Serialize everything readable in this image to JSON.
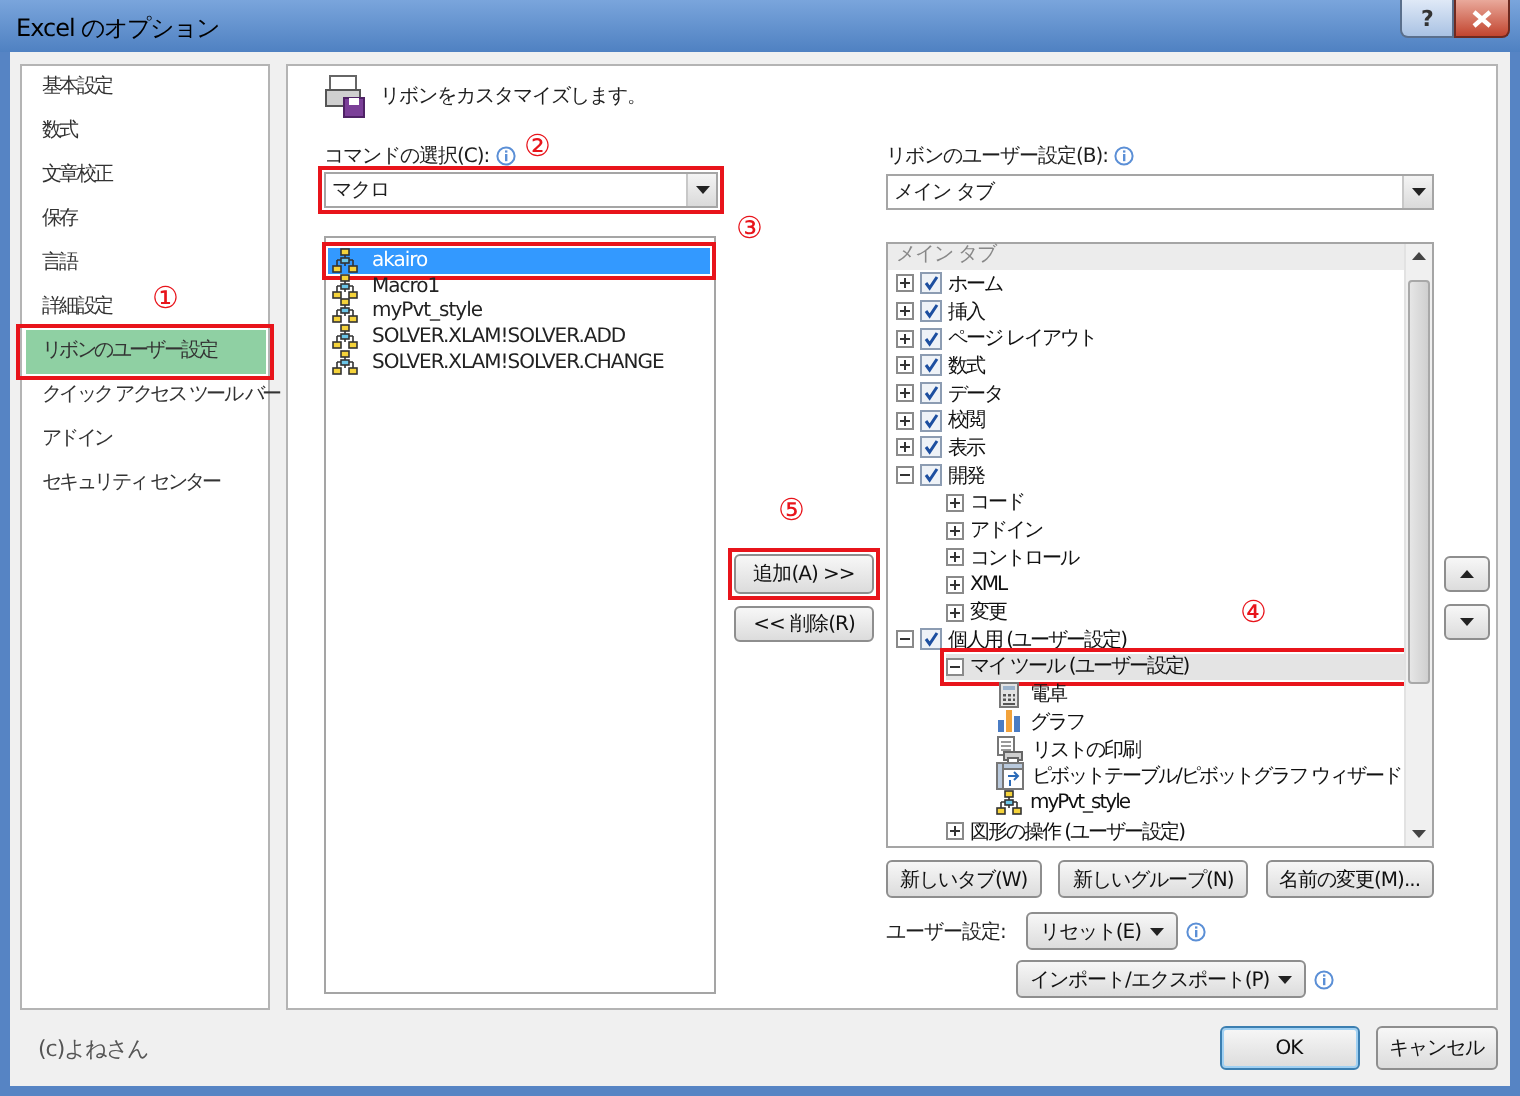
{
  "window": {
    "title": "Excel のオプション",
    "help": "?"
  },
  "nav": {
    "items": [
      {
        "label": "基本設定",
        "selected": false,
        "highlighted": false
      },
      {
        "label": "数式",
        "selected": false,
        "highlighted": false
      },
      {
        "label": "文章校正",
        "selected": false,
        "highlighted": false
      },
      {
        "label": "保存",
        "selected": false,
        "highlighted": false
      },
      {
        "label": "言語",
        "selected": false,
        "highlighted": false
      },
      {
        "label": "詳細設定",
        "selected": false,
        "highlighted": false
      },
      {
        "label": "リボンのユーザー設定",
        "selected": true,
        "highlighted": true,
        "marker": "①"
      },
      {
        "label": "クイック アクセス ツール バー",
        "selected": false,
        "highlighted": false
      },
      {
        "label": "アドイン",
        "selected": false,
        "highlighted": false
      },
      {
        "label": "セキュリティ センター",
        "selected": false,
        "highlighted": false
      }
    ]
  },
  "customize": {
    "heading": "リボンをカスタマイズします。",
    "commands": {
      "label": "コマンドの選択(C):",
      "combo": {
        "value": "マクロ",
        "highlighted": true,
        "marker": "②"
      },
      "items": [
        {
          "label": "akairo",
          "selected": true,
          "highlighted": true,
          "marker": "③"
        },
        {
          "label": "Macro1",
          "selected": false,
          "highlighted": false
        },
        {
          "label": "myPvt_style",
          "selected": false,
          "highlighted": false
        },
        {
          "label": "SOLVER.XLAM!SOLVER.ADD",
          "selected": false,
          "highlighted": false
        },
        {
          "label": "SOLVER.XLAM!SOLVER.CHANGE",
          "selected": false,
          "highlighted": false
        }
      ]
    },
    "move_buttons": [
      {
        "label": "追加(A) >>",
        "highlighted": true,
        "marker": "⑤"
      },
      {
        "label": "<< 削除(R)",
        "highlighted": false
      }
    ],
    "ribbon": {
      "label": "リボンのユーザー設定(B):",
      "combo": {
        "value": "メイン タブ",
        "highlighted": false
      },
      "tree": {
        "header": "メイン タブ",
        "items": [
          {
            "label": "ホーム",
            "kind": "tab",
            "expanded": false,
            "checked": true,
            "selected": false,
            "highlighted": false
          },
          {
            "label": "挿入",
            "kind": "tab",
            "expanded": false,
            "checked": true,
            "selected": false,
            "highlighted": false
          },
          {
            "label": "ページ レイアウト",
            "kind": "tab",
            "expanded": false,
            "checked": true,
            "selected": false,
            "highlighted": false
          },
          {
            "label": "数式",
            "kind": "tab",
            "expanded": false,
            "checked": true,
            "selected": false,
            "highlighted": false
          },
          {
            "label": "データ",
            "kind": "tab",
            "expanded": false,
            "checked": true,
            "selected": false,
            "highlighted": false
          },
          {
            "label": "校閲",
            "kind": "tab",
            "expanded": false,
            "checked": true,
            "selected": false,
            "highlighted": false
          },
          {
            "label": "表示",
            "kind": "tab",
            "expanded": false,
            "checked": true,
            "selected": false,
            "highlighted": false
          },
          {
            "label": "開発",
            "kind": "tab",
            "expanded": true,
            "checked": true,
            "selected": false,
            "highlighted": false,
            "children": [
              {
                "label": "コード",
                "kind": "group",
                "expanded": false,
                "selected": false,
                "highlighted": false
              },
              {
                "label": "アドイン",
                "kind": "group",
                "expanded": false,
                "selected": false,
                "highlighted": false
              },
              {
                "label": "コントロール",
                "kind": "group",
                "expanded": false,
                "selected": false,
                "highlighted": false
              },
              {
                "label": "XML",
                "kind": "group",
                "expanded": false,
                "selected": false,
                "highlighted": false
              },
              {
                "label": "変更",
                "kind": "group",
                "expanded": false,
                "selected": false,
                "highlighted": false
              }
            ]
          },
          {
            "label": "個人用 (ユーザー設定)",
            "kind": "tab",
            "expanded": true,
            "checked": true,
            "selected": false,
            "highlighted": false,
            "children": [
              {
                "label": "マイ ツール (ユーザー設定)",
                "kind": "group",
                "expanded": true,
                "selected": true,
                "highlighted": true,
                "marker": "④",
                "children": [
                  {
                    "label": "電卓",
                    "kind": "calculator",
                    "selected": false,
                    "highlighted": false
                  },
                  {
                    "label": "グラフ",
                    "kind": "chart",
                    "selected": false,
                    "highlighted": false
                  },
                  {
                    "label": "リストの印刷",
                    "kind": "printer",
                    "selected": false,
                    "highlighted": false
                  },
                  {
                    "label": "ピボットテーブル/ピボットグラフ ウィザード",
                    "kind": "pivot",
                    "selected": false,
                    "highlighted": false
                  },
                  {
                    "label": "myPvt_style",
                    "kind": "macro",
                    "selected": false,
                    "highlighted": false
                  }
                ]
              },
              {
                "label": "図形の操作 (ユーザー設定)",
                "kind": "group",
                "expanded": false,
                "selected": false,
                "highlighted": false
              }
            ]
          }
        ]
      },
      "buttons": [
        "新しいタブ(W)",
        "新しいグループ(N)",
        "名前の変更(M)..."
      ],
      "customize_label": "ユーザー設定:",
      "reset": "リセット(E)",
      "import_export": "インポート/エクスポート(P)"
    }
  },
  "footer": {
    "credit": "(c)よねさん",
    "buttons": [
      {
        "label": "OK",
        "default": true
      },
      {
        "label": "キャンセル",
        "default": false
      }
    ]
  }
}
